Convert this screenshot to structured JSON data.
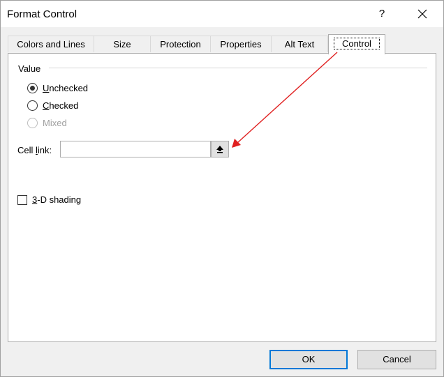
{
  "window": {
    "title": "Format Control",
    "help_label": "?"
  },
  "tabs": [
    {
      "label": "Colors and Lines"
    },
    {
      "label": "Size"
    },
    {
      "label": "Protection"
    },
    {
      "label": "Properties"
    },
    {
      "label": "Alt Text"
    },
    {
      "label": "Control",
      "active": true
    }
  ],
  "value_group": {
    "label": "Value",
    "options": [
      {
        "underline": "U",
        "rest": "nchecked",
        "selected": true
      },
      {
        "underline": "C",
        "rest": "hecked"
      },
      {
        "underline": "",
        "rest": "Mixed",
        "disabled": true
      }
    ]
  },
  "cell_link": {
    "label_pre": "Cell ",
    "label_u": "l",
    "label_post": "ink:",
    "value": "",
    "button_icon": "collapse-dialog-icon"
  },
  "shading": {
    "underline": "3",
    "rest": "-D shading",
    "checked": false
  },
  "buttons": {
    "ok": "OK",
    "cancel": "Cancel"
  },
  "annotation": {
    "color": "#e02020",
    "icon": "red-arrow-annotation"
  },
  "colors": {
    "ok_border": "#0078d7"
  }
}
